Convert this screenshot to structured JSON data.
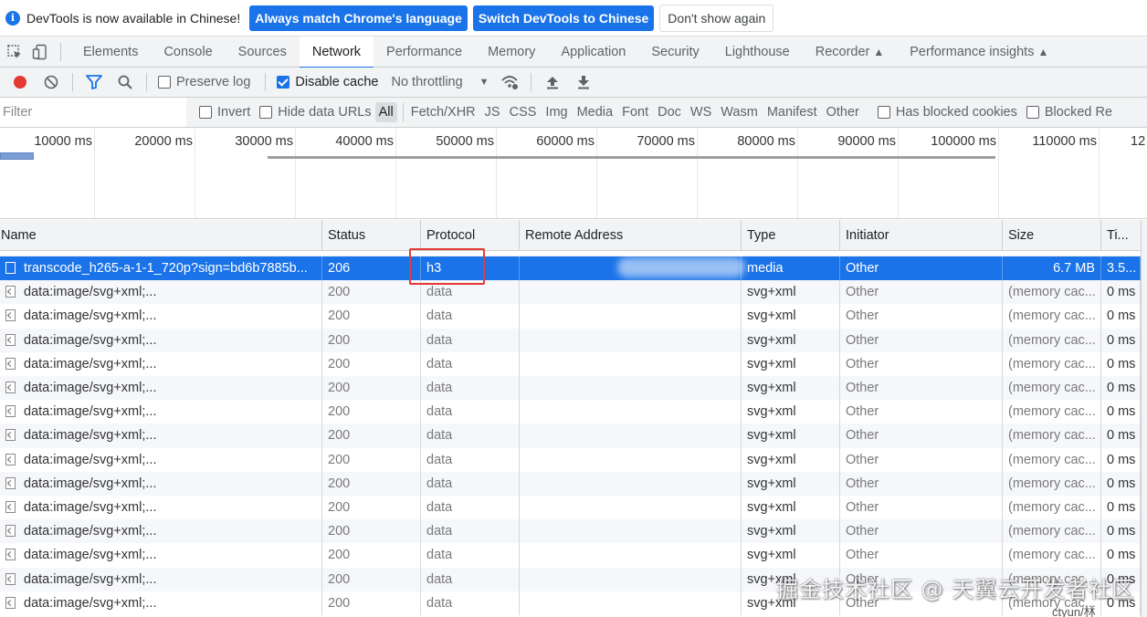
{
  "infobar": {
    "message": "DevTools is now available in Chinese!",
    "btn_match": "Always match Chrome's language",
    "btn_switch": "Switch DevTools to Chinese",
    "btn_dismiss": "Don't show again"
  },
  "tabs": [
    "Elements",
    "Console",
    "Sources",
    "Network",
    "Performance",
    "Memory",
    "Application",
    "Security",
    "Lighthouse",
    "Recorder",
    "Performance insights"
  ],
  "active_tab": "Network",
  "toolbar": {
    "preserve_log": "Preserve log",
    "disable_cache": "Disable cache",
    "throttling": "No throttling"
  },
  "filterbar": {
    "filter_placeholder": "Filter",
    "invert": "Invert",
    "hide_data_urls": "Hide data URLs",
    "types": [
      "All",
      "Fetch/XHR",
      "JS",
      "CSS",
      "Img",
      "Media",
      "Font",
      "Doc",
      "WS",
      "Wasm",
      "Manifest",
      "Other"
    ],
    "active_type": "All",
    "has_blocked_cookies": "Has blocked cookies",
    "blocked_requests": "Blocked Re"
  },
  "overview": {
    "labels": [
      "10000 ms",
      "20000 ms",
      "30000 ms",
      "40000 ms",
      "50000 ms",
      "60000 ms",
      "70000 ms",
      "80000 ms",
      "90000 ms",
      "100000 ms",
      "110000 ms",
      "12"
    ]
  },
  "columns": {
    "name": "Name",
    "status": "Status",
    "protocol": "Protocol",
    "remote_address": "Remote Address",
    "type": "Type",
    "initiator": "Initiator",
    "size": "Size",
    "time": "Ti..."
  },
  "rows": [
    {
      "name": "transcode_h265-a-1-1_720p?sign=bd6b7885b...",
      "status": "206",
      "protocol": "h3",
      "remote": "",
      "type": "media",
      "initiator": "Other",
      "size": "6.7 MB",
      "time": "3.5...",
      "selected": true
    },
    {
      "name": "data:image/svg+xml;...",
      "status": "200",
      "protocol": "data",
      "remote": "",
      "type": "svg+xml",
      "initiator": "Other",
      "size": "(memory cac...",
      "time": "0 ms"
    },
    {
      "name": "data:image/svg+xml;...",
      "status": "200",
      "protocol": "data",
      "remote": "",
      "type": "svg+xml",
      "initiator": "Other",
      "size": "(memory cac...",
      "time": "0 ms"
    },
    {
      "name": "data:image/svg+xml;...",
      "status": "200",
      "protocol": "data",
      "remote": "",
      "type": "svg+xml",
      "initiator": "Other",
      "size": "(memory cac...",
      "time": "0 ms"
    },
    {
      "name": "data:image/svg+xml;...",
      "status": "200",
      "protocol": "data",
      "remote": "",
      "type": "svg+xml",
      "initiator": "Other",
      "size": "(memory cac...",
      "time": "0 ms"
    },
    {
      "name": "data:image/svg+xml;...",
      "status": "200",
      "protocol": "data",
      "remote": "",
      "type": "svg+xml",
      "initiator": "Other",
      "size": "(memory cac...",
      "time": "0 ms"
    },
    {
      "name": "data:image/svg+xml;...",
      "status": "200",
      "protocol": "data",
      "remote": "",
      "type": "svg+xml",
      "initiator": "Other",
      "size": "(memory cac...",
      "time": "0 ms"
    },
    {
      "name": "data:image/svg+xml;...",
      "status": "200",
      "protocol": "data",
      "remote": "",
      "type": "svg+xml",
      "initiator": "Other",
      "size": "(memory cac...",
      "time": "0 ms"
    },
    {
      "name": "data:image/svg+xml;...",
      "status": "200",
      "protocol": "data",
      "remote": "",
      "type": "svg+xml",
      "initiator": "Other",
      "size": "(memory cac...",
      "time": "0 ms"
    },
    {
      "name": "data:image/svg+xml;...",
      "status": "200",
      "protocol": "data",
      "remote": "",
      "type": "svg+xml",
      "initiator": "Other",
      "size": "(memory cac...",
      "time": "0 ms"
    },
    {
      "name": "data:image/svg+xml;...",
      "status": "200",
      "protocol": "data",
      "remote": "",
      "type": "svg+xml",
      "initiator": "Other",
      "size": "(memory cac...",
      "time": "0 ms"
    },
    {
      "name": "data:image/svg+xml;...",
      "status": "200",
      "protocol": "data",
      "remote": "",
      "type": "svg+xml",
      "initiator": "Other",
      "size": "(memory cac...",
      "time": "0 ms"
    },
    {
      "name": "data:image/svg+xml;...",
      "status": "200",
      "protocol": "data",
      "remote": "",
      "type": "svg+xml",
      "initiator": "Other",
      "size": "(memory cac...",
      "time": "0 ms"
    },
    {
      "name": "data:image/svg+xml;...",
      "status": "200",
      "protocol": "data",
      "remote": "",
      "type": "svg+xml",
      "initiator": "Other",
      "size": "(memory cac...",
      "time": "0 ms"
    },
    {
      "name": "data:image/svg+xml;...",
      "status": "200",
      "protocol": "data",
      "remote": "",
      "type": "svg+xml",
      "initiator": "Other",
      "size": "(memory cac...",
      "time": "0 ms"
    }
  ],
  "watermark": "掘金技术社区 @ 天翼云开发者社区",
  "source_mark": "ctyun/林",
  "colors": {
    "accent": "#1a73e8",
    "record": "#e53935",
    "highlight": "#e53935"
  }
}
